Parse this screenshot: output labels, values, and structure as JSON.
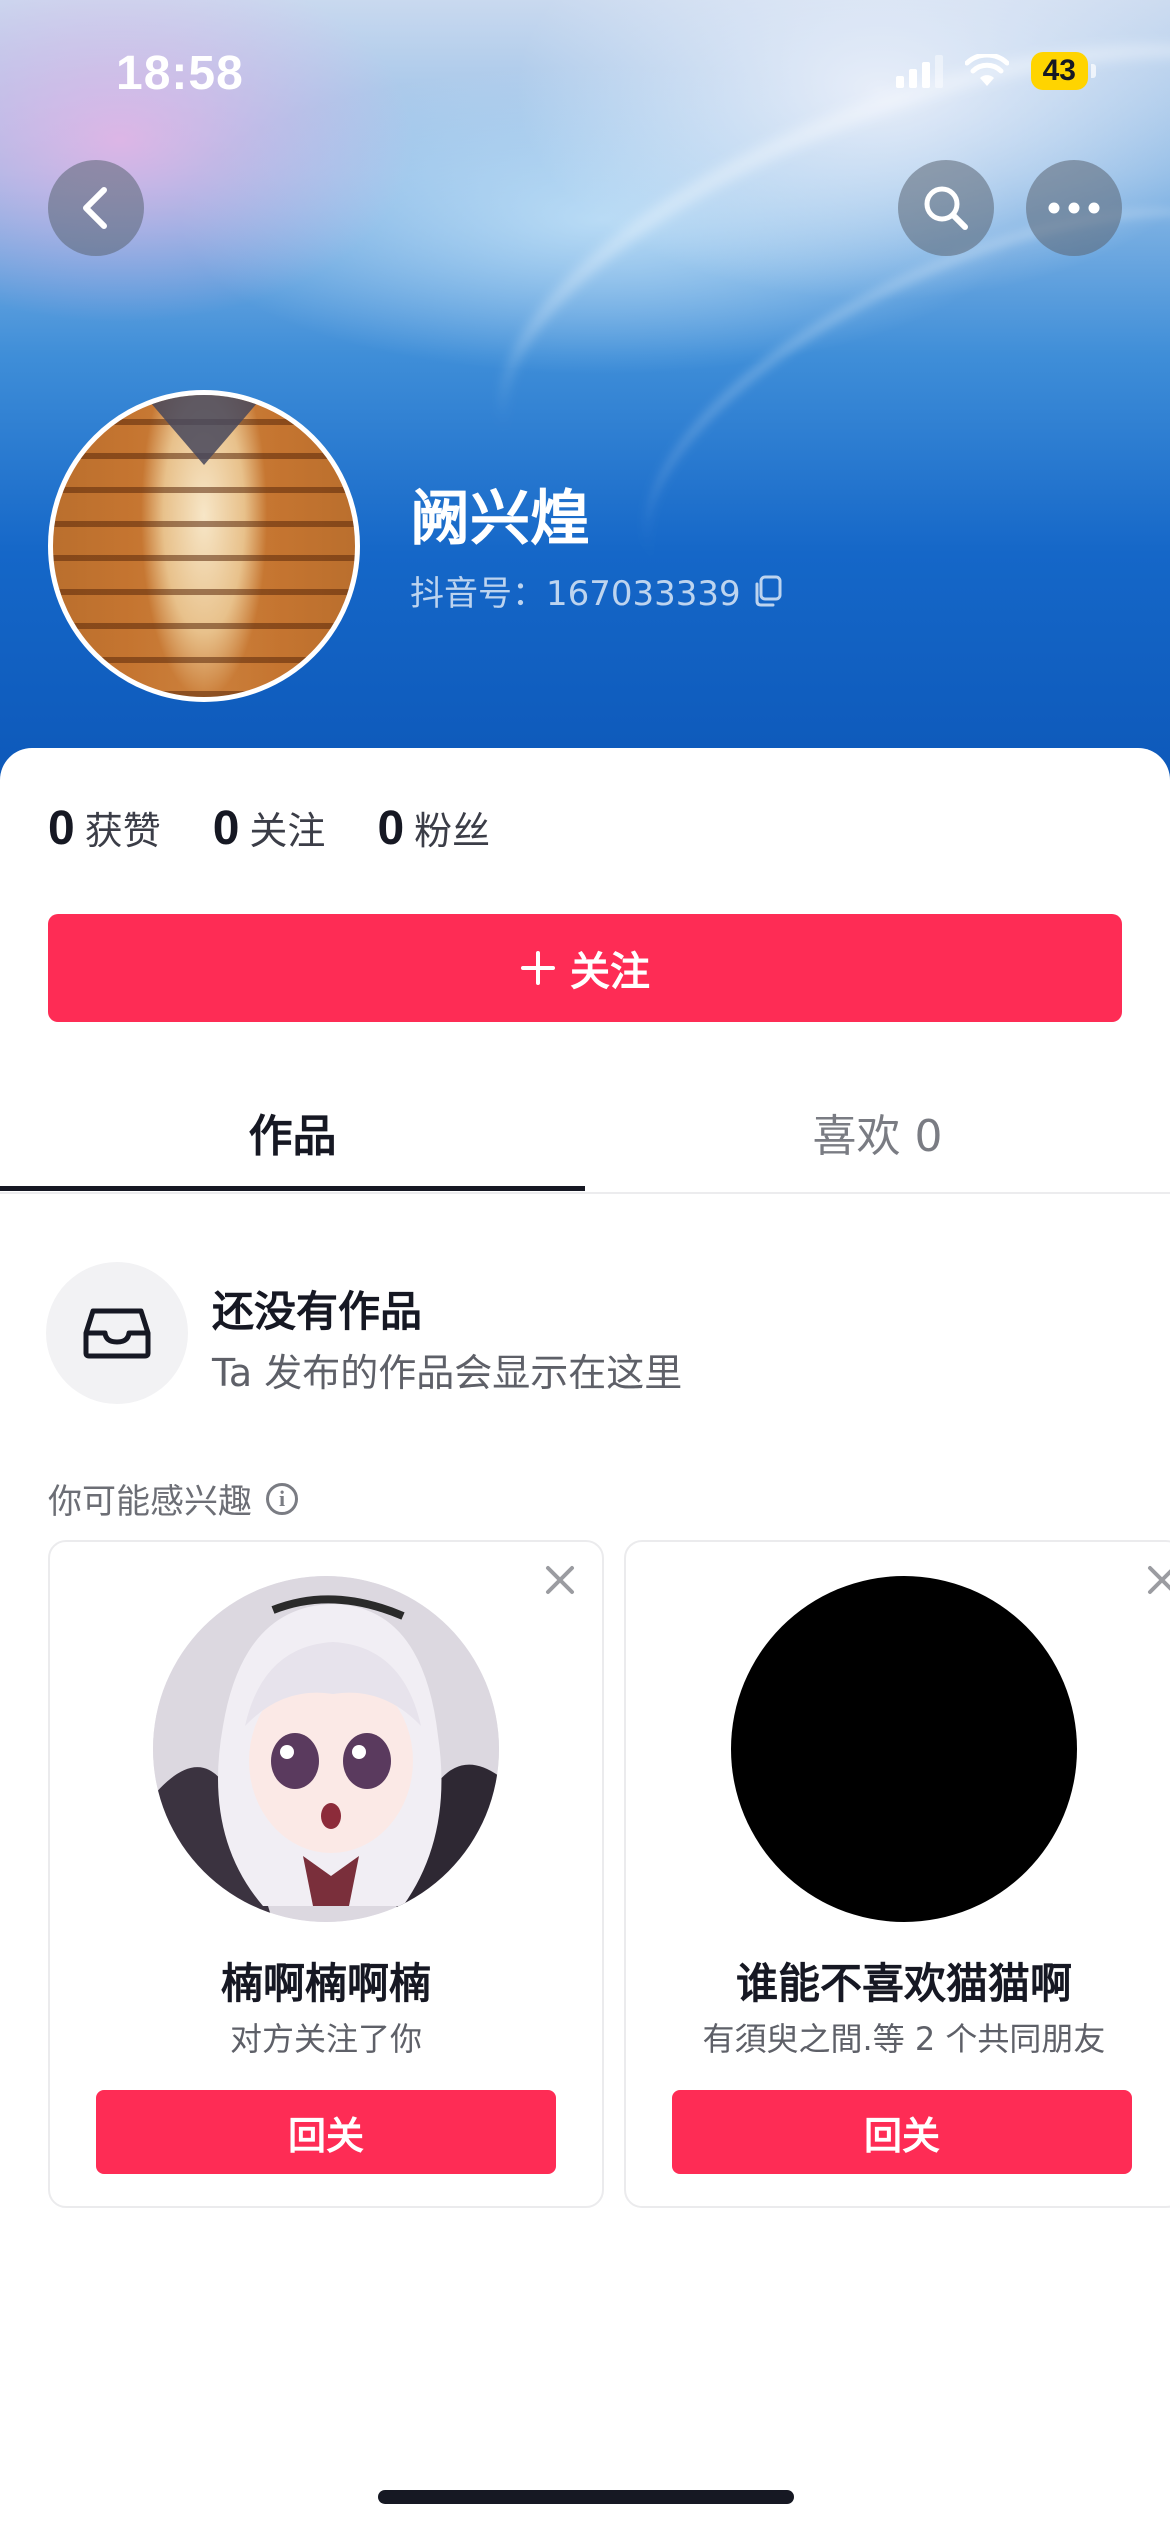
{
  "status_bar": {
    "time": "18:58",
    "battery": "43",
    "battery_color": "#ffd400"
  },
  "header": {
    "back_icon": "chevron-left-icon",
    "search_icon": "search-icon",
    "more_icon": "more-icon"
  },
  "profile": {
    "name": "阙兴煌",
    "id_label": "抖音号：167033339",
    "copy_icon": "copy-icon"
  },
  "stats": [
    {
      "value": "0",
      "label": "获赞"
    },
    {
      "value": "0",
      "label": "关注"
    },
    {
      "value": "0",
      "label": "粉丝"
    }
  ],
  "follow_button": {
    "icon": "plus-icon",
    "label": "关注"
  },
  "tabs": [
    {
      "label": "作品",
      "active": true
    },
    {
      "label": "喜欢 0",
      "active": false
    }
  ],
  "empty_state": {
    "icon": "inbox-icon",
    "title": "还没有作品",
    "subtitle": "Ta 发布的作品会显示在这里"
  },
  "recommendations": {
    "header": "你可能感兴趣",
    "info_icon": "info-icon",
    "cards": [
      {
        "name": "楠啊楠啊楠",
        "subtitle": "对方关注了你",
        "button": "回关",
        "close_icon": "close-icon"
      },
      {
        "name": "谁能不喜欢猫猫啊",
        "subtitle": "有須臾之間.等 2 个共同朋友",
        "button": "回关",
        "close_icon": "close-icon"
      }
    ]
  },
  "colors": {
    "accent": "#fe2c55",
    "text_primary": "#161823",
    "text_secondary": "#5e6068"
  }
}
